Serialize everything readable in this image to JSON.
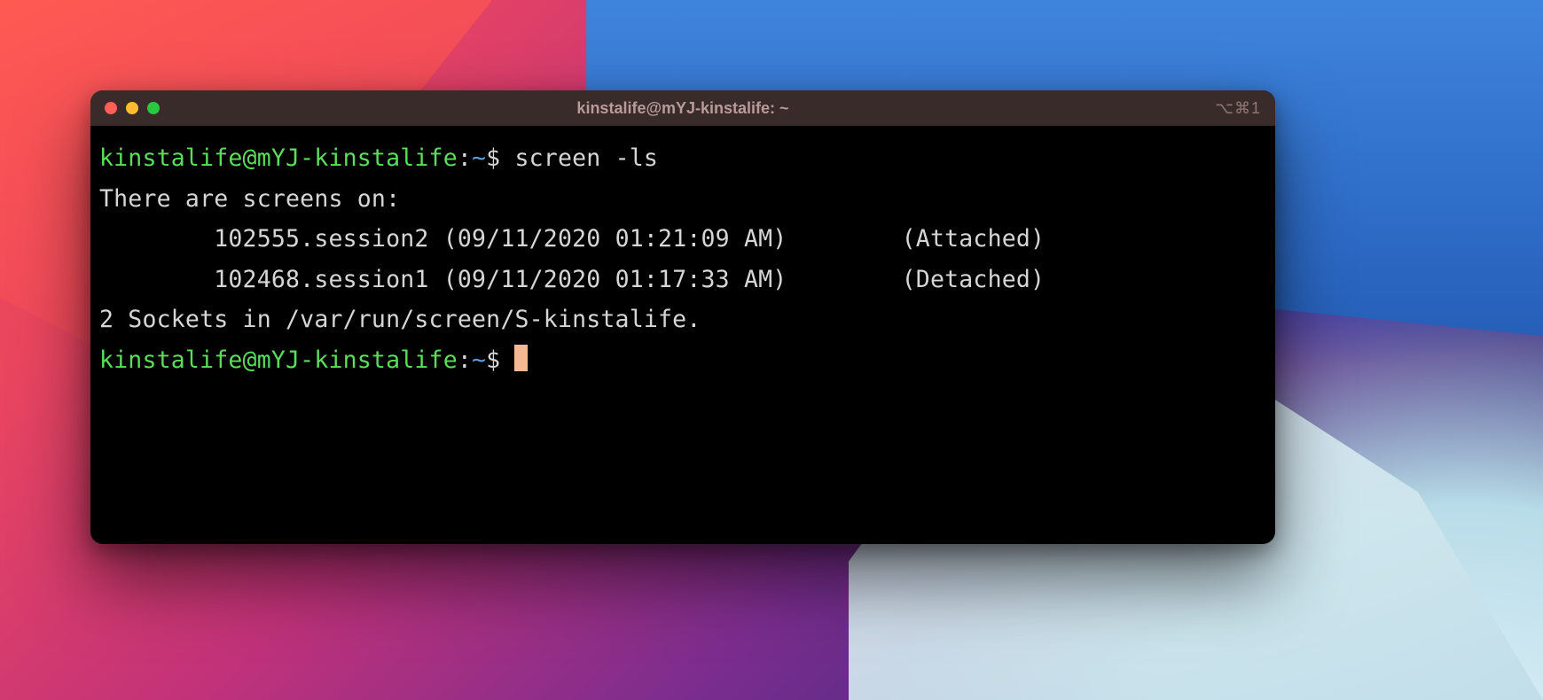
{
  "window": {
    "title": "kinstalife@mYJ-kinstalife: ~",
    "shortcut": "⌥⌘1"
  },
  "prompt": {
    "user_host": "kinstalife@mYJ-kinstalife",
    "separator": ":",
    "path": "~",
    "symbol": "$"
  },
  "lines": {
    "command1": "screen -ls",
    "output_header": "There are screens on:",
    "session1_name": "102555.session2",
    "session1_date": "(09/11/2020 01:21:09 AM)",
    "session1_status": "(Attached)",
    "session2_name": "102468.session1",
    "session2_date": "(09/11/2020 01:17:33 AM)",
    "session2_status": "(Detached)",
    "sockets_summary": "2 Sockets in /var/run/screen/S-kinstalife."
  },
  "colors": {
    "prompt_green": "#5cdc5c",
    "prompt_blue": "#5a9ee0",
    "terminal_bg": "#000000",
    "titlebar_bg": "#3a2b2b",
    "text": "#d6d6d6",
    "cursor": "#f5b894"
  }
}
